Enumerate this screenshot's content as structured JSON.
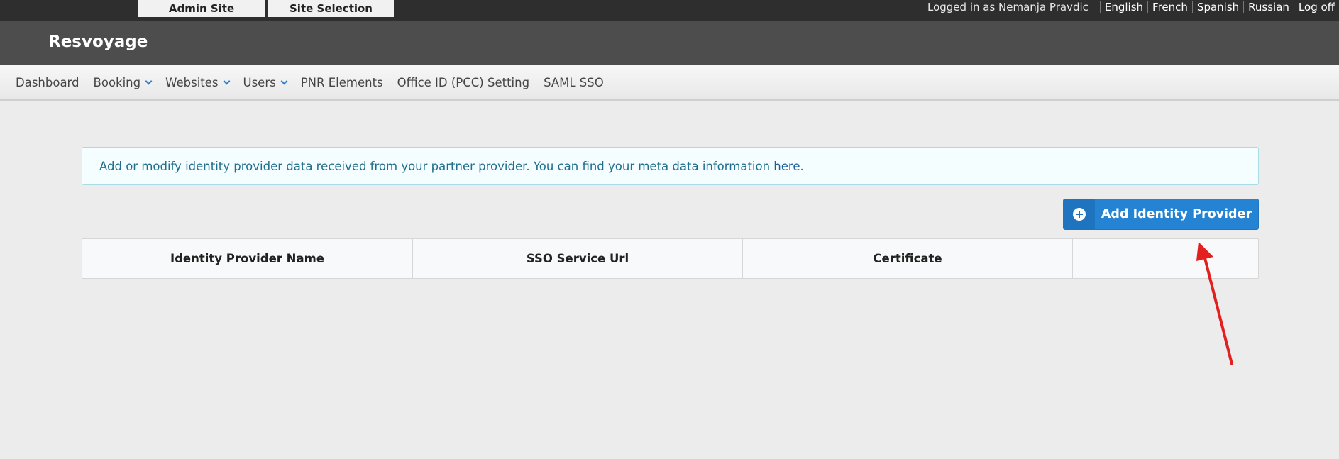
{
  "topbar": {
    "tabs": [
      "Admin Site",
      "Site Selection"
    ],
    "logged_in_text": "Logged in as Nemanja Pravdic",
    "languages": [
      "English",
      "French",
      "Spanish",
      "Russian"
    ],
    "logoff": "Log off"
  },
  "brand": {
    "title": "Resvoyage"
  },
  "nav": {
    "items": [
      {
        "label": "Dashboard",
        "dropdown": false
      },
      {
        "label": "Booking",
        "dropdown": true
      },
      {
        "label": "Websites",
        "dropdown": true
      },
      {
        "label": "Users",
        "dropdown": true
      },
      {
        "label": "PNR Elements",
        "dropdown": false
      },
      {
        "label": "Office ID (PCC) Setting",
        "dropdown": false
      },
      {
        "label": "SAML SSO",
        "dropdown": false
      }
    ]
  },
  "info": {
    "text": "Add or modify identity provider data received from your partner provider. You can find your meta data information ",
    "link": "here",
    "end": "."
  },
  "add_button": {
    "label": "Add Identity Provider",
    "icon": "plus-circle-icon"
  },
  "table": {
    "headers": [
      "Identity Provider Name",
      "SSO Service Url",
      "Certificate",
      ""
    ]
  },
  "colors": {
    "accent": "#2583d4",
    "annotation_arrow": "#e32020"
  }
}
